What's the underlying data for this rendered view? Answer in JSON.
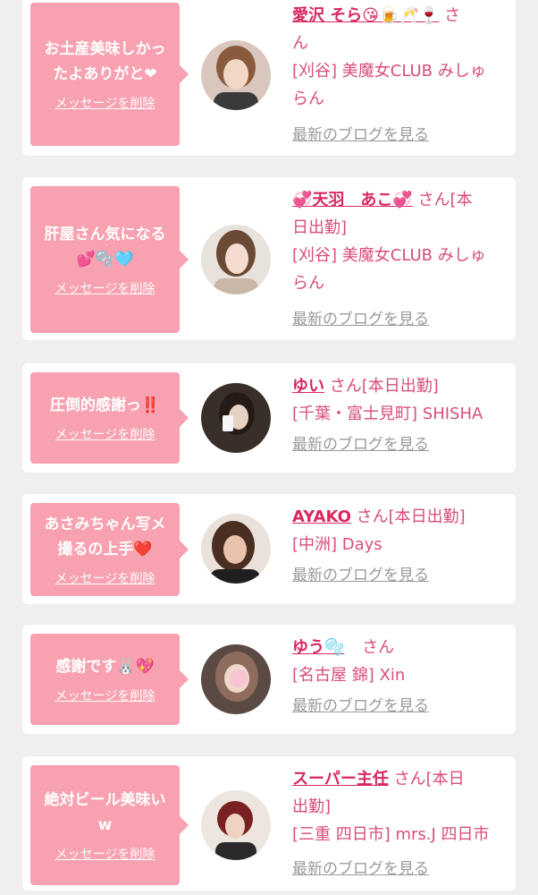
{
  "entries": [
    {
      "message": "お土産美味しかっ\nたよありがと❤",
      "delete_label": "メッセージを削除",
      "name": "愛沢 そら😘🍺🥂🍷",
      "honorific": "さ\nん",
      "shop": "[刈谷] 美魔女CLUB みしゅ\nらん",
      "blog_label": "最新のブログを見る",
      "avatar_icon": "profile-photo"
    },
    {
      "message": "肝屋さん気になる\n💕🫧🩵",
      "delete_label": "メッセージを削除",
      "name": "💞天羽　あこ💞",
      "honorific": "さん[本\n日出勤]",
      "shop": "[刈谷] 美魔女CLUB みしゅ\nらん",
      "blog_label": "最新のブログを見る",
      "avatar_icon": "profile-photo"
    },
    {
      "message": "圧倒的感謝っ‼️",
      "delete_label": "メッセージを削除",
      "name": "ゆい",
      "honorific": "さん[本日出勤]",
      "shop": "[千葉・富士見町] SHISHA",
      "blog_label": "最新のブログを見る",
      "avatar_icon": "profile-photo"
    },
    {
      "message": "あさみちゃん写メ\n撮るの上手❤️",
      "delete_label": "メッセージを削除",
      "name": "AYAKO",
      "honorific": "さん[本日出勤]",
      "shop": "[中洲] Days",
      "blog_label": "最新のブログを見る",
      "avatar_icon": "profile-photo"
    },
    {
      "message": "感謝です🐰💖",
      "delete_label": "メッセージを削除",
      "name": "ゆう🫧",
      "honorific": "さん",
      "shop": "[名古屋 錦] Xin",
      "blog_label": "最新のブログを見る",
      "avatar_icon": "profile-photo"
    },
    {
      "message": "絶対ビール美味い\nw",
      "delete_label": "メッセージを削除",
      "name": "スーパー主任",
      "honorific": "さん[本日\n出勤]",
      "shop": "[三重 四日市] mrs.J 四日市",
      "blog_label": "最新のブログを見る",
      "avatar_icon": "profile-photo"
    }
  ]
}
